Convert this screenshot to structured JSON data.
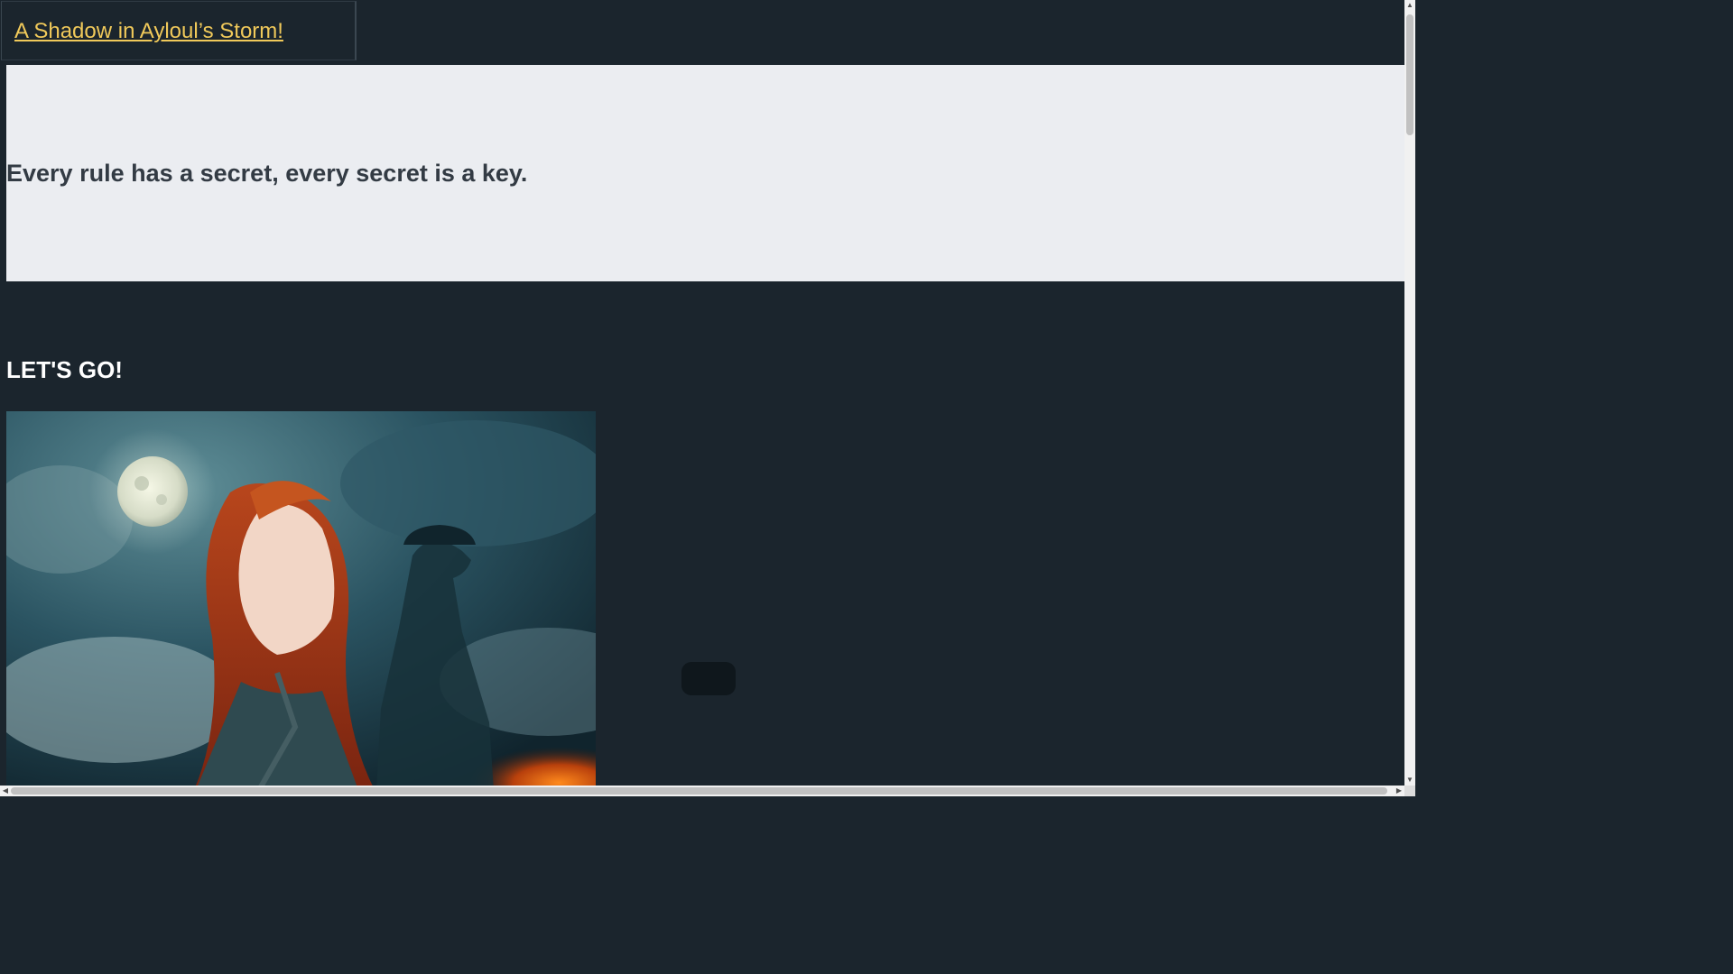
{
  "header": {
    "title": "A Shadow in Ayloul’s Storm!"
  },
  "banner": {
    "tagline": "Every rule has a secret, every secret is a key."
  },
  "main": {
    "heading": "LET'S GO!",
    "hero_image": "cover-art-red-haired-woman-moon-shadow",
    "play_button_label": ""
  },
  "colors": {
    "page_bg": "#1b252d",
    "title_link": "#f0c95a",
    "banner_bg": "#ebedf1",
    "banner_text": "#333b44"
  },
  "icons": {
    "scroll_up": "arrow-up-icon",
    "scroll_down": "arrow-down-icon",
    "scroll_left": "arrow-left-icon",
    "scroll_right": "arrow-right-icon"
  }
}
